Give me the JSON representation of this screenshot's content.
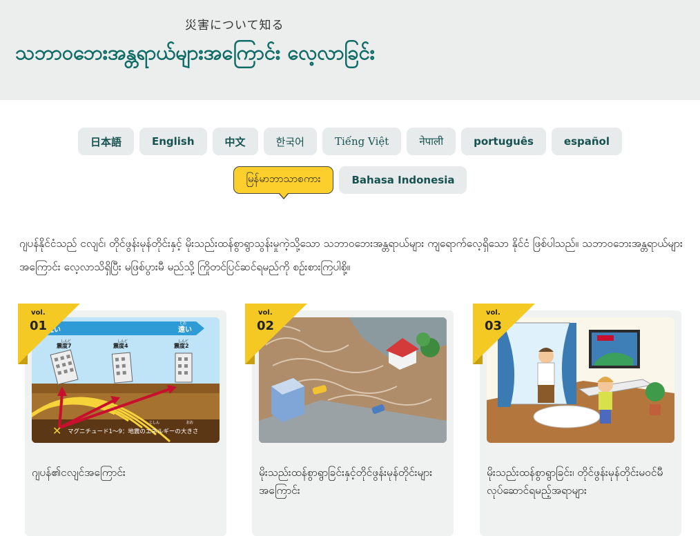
{
  "header": {
    "kicker": "災害について知る",
    "title": "သဘာဝဘေးအန္တရာယ်များအကြောင်း လေ့လာခြင်း"
  },
  "languages": {
    "row1": [
      "日本語",
      "English",
      "中文",
      "한국어",
      "Tiếng Việt",
      "नेपाली",
      "português",
      "español"
    ],
    "row2": [
      "မြန်မာဘာသာစကား",
      "Bahasa Indonesia"
    ],
    "active": "မြန်မာဘာသာစကား"
  },
  "intro": "ဂျပန်နိုင်ငံသည် ငလျင်၊ တိုင်ဖွန်းမုန်တိုင်းနှင့် မိုးသည်းထန်စွာရွာသွန်းမှုကဲ့သို့သော သဘာဝဘေးအန္တရာယ်များ ကျရောက်လေ့ရှိသော နိုင်ငံ ဖြစ်ပါသည်။ သဘာဝဘေးအန္တရာယ်များအကြောင်း လေ့လာသိရှိပြီး မဖြစ်ပွားမီ မည်သို့ ကြိုတင်ပြင်ဆင်ရမည်ကို စဉ်းစားကြပါစို့။",
  "cards": [
    {
      "vol": "vol.",
      "num": "01",
      "caption": "ဂျပန်၏ငလျင်အကြောင်း",
      "image_text": {
        "near": "近い",
        "near_ruby": "ちか",
        "far": "遠い",
        "far_ruby": "とお",
        "s7": "震度7",
        "s4": "震度4",
        "s2": "震度2",
        "shindo_ruby": "しんど",
        "magnitude": "マグニチュード1〜9：地震のエネルギーの大きさ",
        "jishin_ruby": "じしん",
        "oo_ruby": "おお"
      }
    },
    {
      "vol": "vol.",
      "num": "02",
      "caption": "မိုးသည်းထန်စွာရွာခြင်းနှင့်တိုင်ဖွန်းမုန်တိုင်းများအကြောင်း"
    },
    {
      "vol": "vol.",
      "num": "03",
      "caption": "မိုးသည်းထန်စွာရွာခြင်း၊ တိုင်ဖွန်းမုန်တိုင်းမဝင်မီ လုပ်ဆောင်ရမည့်အရာများ"
    }
  ],
  "colors": {
    "header_bg": "#eceeee",
    "title": "#0e6b66",
    "lang_bg": "#e8ebeb",
    "lang_text": "#16524f",
    "active_lang": "#fccf2d",
    "badge": "#f5c923",
    "card_bg": "#f0f1f1"
  }
}
